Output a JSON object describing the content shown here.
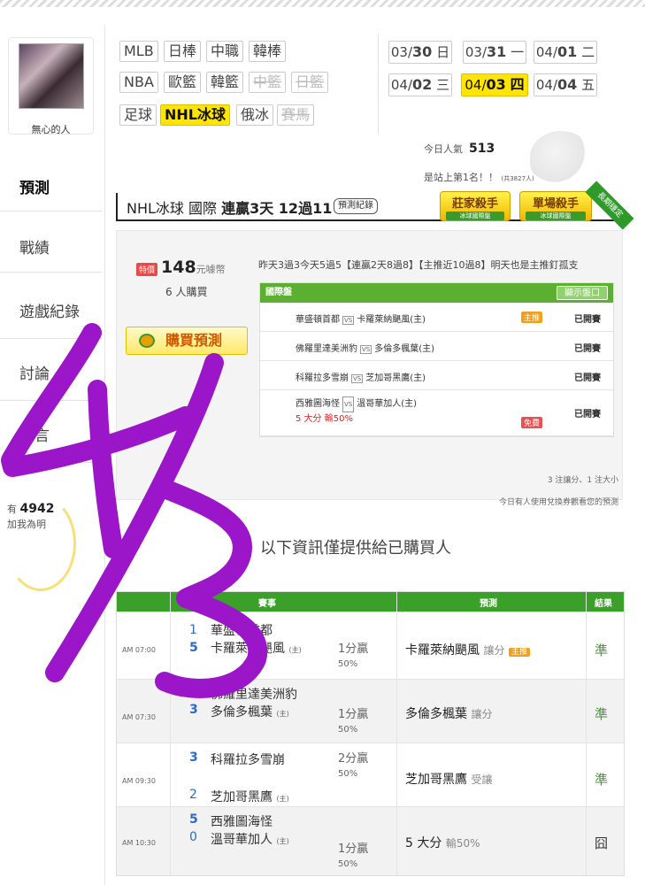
{
  "user": {
    "name": "無心的人",
    "fans_count": "4942",
    "fans_prefix": "有",
    "follow_text": "加我為明"
  },
  "sidebar": {
    "items": [
      {
        "label": "預測",
        "active": true
      },
      {
        "label": "戰績",
        "active": false
      },
      {
        "label": "遊戲紀錄",
        "active": false
      },
      {
        "label": "討論",
        "active": false
      },
      {
        "label": "留言",
        "active": false
      }
    ]
  },
  "leagues": {
    "row1": [
      {
        "label": "MLB"
      },
      {
        "label": "日棒"
      },
      {
        "label": "中職"
      },
      {
        "label": "韓棒"
      }
    ],
    "row2": [
      {
        "label": "NBA"
      },
      {
        "label": "歐籃"
      },
      {
        "label": "韓籃"
      },
      {
        "label": "中籃",
        "disabled": true
      },
      {
        "label": "日籃",
        "disabled": true
      }
    ],
    "row3": [
      {
        "label": "足球"
      },
      {
        "label": "NHL冰球",
        "selected": true
      },
      {
        "label": "俄冰"
      },
      {
        "label": "賽馬",
        "disabled": true
      }
    ]
  },
  "dates": [
    {
      "md": "03/",
      "day": "30",
      "wd": "日"
    },
    {
      "md": "03/",
      "day": "31",
      "wd": "一"
    },
    {
      "md": "04/",
      "day": "01",
      "wd": "二"
    },
    {
      "md": "04/",
      "day": "02",
      "wd": "三"
    },
    {
      "md": "04/",
      "day": "03",
      "wd": "四",
      "selected": true
    },
    {
      "md": "04/",
      "day": "04",
      "wd": "五"
    }
  ],
  "popularity": {
    "label": "今日人氣",
    "value": "513",
    "rank_text": "是站上第1名！！",
    "rank_note": "(共3827人)"
  },
  "title": {
    "league": "NHL冰球 國際 ",
    "streak": "連贏3天 12過11",
    "record_button": "預測紀錄"
  },
  "badges": [
    {
      "title": "莊家殺手",
      "sub": "冰球國際盤"
    },
    {
      "title": "單場殺手",
      "sub": "冰球國際盤"
    }
  ],
  "ribbon": "長期穩定",
  "purchase": {
    "price_tag": "特價",
    "price": "148",
    "price_unit": "元噱幣",
    "buyers": "6 人購買",
    "buy_button": "購買預測",
    "summary": "昨天3過3今天5過5【連贏2天8過8】【主推近10過8】明天也是主推釘孤支"
  },
  "games_table": {
    "header": "國際盤",
    "show_button": "顯示盤口",
    "rows": [
      {
        "away": "華盛頓首都",
        "home": "卡羅萊納颶風(主)",
        "tag": "主推",
        "status": "已開賽"
      },
      {
        "away": "佛羅里達美洲豹",
        "home": "多倫多楓葉(主)",
        "tag": "",
        "status": "已開賽"
      },
      {
        "away": "科羅拉多雪崩",
        "home": "芝加哥黑鷹(主)",
        "tag": "",
        "status": "已開賽"
      },
      {
        "away": "西雅圖海怪",
        "home": "溫哥華加人(主)",
        "extra": "5 大分 輸50%",
        "tag": "免費",
        "status": "已開賽"
      }
    ],
    "foot1": "3 注讓分、1 注大小",
    "foot2": "今日有人使用兌換券觀看您的預測"
  },
  "info_note": "以下資訊僅提供給已購買人",
  "results_table": {
    "headers": {
      "match": "賽事",
      "pick": "預測",
      "result": "結果"
    },
    "rows": [
      {
        "time": "AM 07:00",
        "away_score": "1",
        "away": "華盛頓首都",
        "home_score": "5",
        "home": "卡羅萊納颶風",
        "home_tag": "(主)",
        "line": "1分贏",
        "line_pct": "50%",
        "pick": "卡羅萊納颶風",
        "pick_type": "讓分",
        "pick_tag": "主推",
        "result": "準"
      },
      {
        "time": "AM 07:30",
        "away_score": "2",
        "away": "佛羅里達美洲豹",
        "home_score": "3",
        "home": "多倫多楓葉",
        "home_tag": "(主)",
        "line": "1分贏",
        "line_pct": "50%",
        "pick": "多倫多楓葉",
        "pick_type": "讓分",
        "pick_tag": "",
        "result": "準"
      },
      {
        "time": "AM 09:30",
        "away_score": "3",
        "away": "科羅拉多雪崩",
        "home_score": "2",
        "home": "芝加哥黑鷹",
        "home_tag": "(主)",
        "line": "2分贏",
        "line_pct": "50%",
        "pick": "芝加哥黑鷹",
        "pick_type": "受讓",
        "pick_tag": "",
        "result": "準"
      },
      {
        "time": "AM 10:30",
        "away_score": "5",
        "away": "西雅圖海怪",
        "home_score": "0",
        "home": "溫哥華加人",
        "home_tag": "(主)",
        "line": "1分贏",
        "line_pct": "50%",
        "pick": "5 大分",
        "pick_type": "輸50%",
        "pick_tag": "",
        "result": "囧"
      }
    ]
  },
  "handwriting": "4/3",
  "colors": {
    "accent_yellow": "#ffe500",
    "header_green": "#3aa02a",
    "win_green": "#3a9a2a",
    "ink_purple": "#9b16c8"
  }
}
